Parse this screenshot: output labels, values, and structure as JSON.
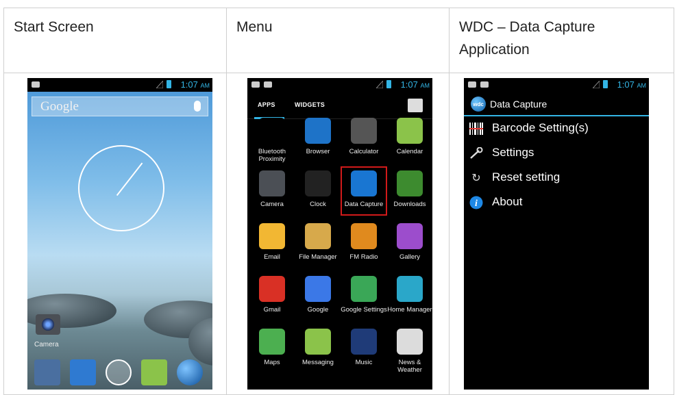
{
  "columns": [
    {
      "header": "Start Screen"
    },
    {
      "header": "Menu"
    },
    {
      "header": "WDC – Data Capture Application"
    }
  ],
  "status_bar": {
    "time": "1:07",
    "ampm": "AM"
  },
  "start_screen": {
    "search_text": "Google",
    "shortcut_label": "Camera"
  },
  "menu": {
    "tabs": [
      "APPS",
      "WIDGETS"
    ],
    "apps": [
      {
        "label": "Bluetooth Proximity",
        "icon": "bluetooth-icon",
        "color": "#000000"
      },
      {
        "label": "Browser",
        "icon": "globe-icon",
        "color": "#1e73c8"
      },
      {
        "label": "Calculator",
        "icon": "calculator-icon",
        "color": "#555555"
      },
      {
        "label": "Calendar",
        "icon": "calendar-icon",
        "color": "#8bc34a"
      },
      {
        "label": "Camera",
        "icon": "camera-icon",
        "color": "#4b4f55"
      },
      {
        "label": "Clock",
        "icon": "clock-icon",
        "color": "#222222"
      },
      {
        "label": "Data Capture",
        "icon": "wdc-icon",
        "color": "#1976d2",
        "highlight": true
      },
      {
        "label": "Downloads",
        "icon": "download-icon",
        "color": "#3d8b2f"
      },
      {
        "label": "Email",
        "icon": "email-icon",
        "color": "#f2b733"
      },
      {
        "label": "File Manager",
        "icon": "folder-icon",
        "color": "#d7a94b"
      },
      {
        "label": "FM Radio",
        "icon": "radio-icon",
        "color": "#e08a1e"
      },
      {
        "label": "Gallery",
        "icon": "gallery-icon",
        "color": "#9c4dcc"
      },
      {
        "label": "Gmail",
        "icon": "gmail-icon",
        "color": "#d93025"
      },
      {
        "label": "Google",
        "icon": "google-icon",
        "color": "#3b78e7"
      },
      {
        "label": "Google Settings",
        "icon": "google-settings-icon",
        "color": "#3aa757"
      },
      {
        "label": "Home Manager",
        "icon": "wrench-icon",
        "color": "#2aa7c9"
      },
      {
        "label": "Maps",
        "icon": "maps-icon",
        "color": "#4caf50"
      },
      {
        "label": "Messaging",
        "icon": "messaging-icon",
        "color": "#8bc34a"
      },
      {
        "label": "Music",
        "icon": "music-icon",
        "color": "#1f3b78"
      },
      {
        "label": "News & Weather",
        "icon": "news-icon",
        "color": "#dcdcdc"
      }
    ]
  },
  "wdc": {
    "title": "Data Capture",
    "logo_text": "wdc",
    "items": [
      {
        "label": "Barcode Setting(s)",
        "icon": "barcode-icon"
      },
      {
        "label": "Settings",
        "icon": "wrench-icon"
      },
      {
        "label": "Reset setting",
        "icon": "reset-icon"
      },
      {
        "label": "About",
        "icon": "info-icon"
      }
    ]
  }
}
